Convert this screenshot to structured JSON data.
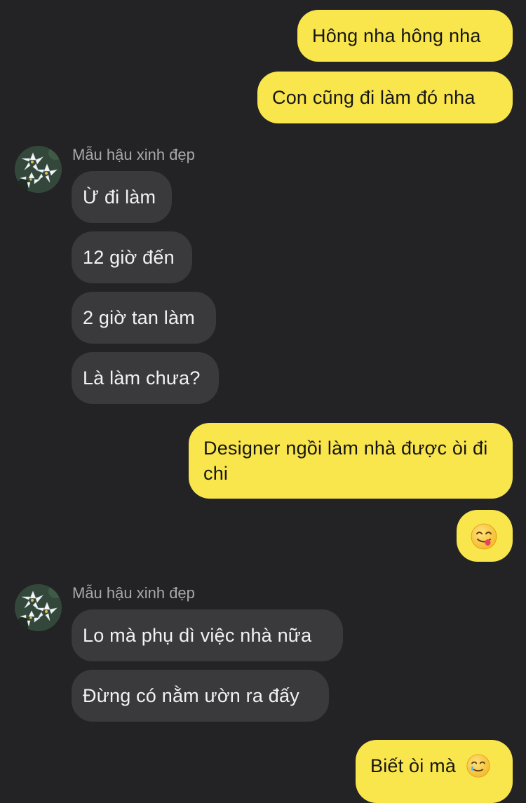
{
  "messages": [
    {
      "side": "out",
      "text": "Hông nha hông nha"
    },
    {
      "side": "out",
      "text": "Con cũng đi làm đó nha"
    },
    {
      "side": "in_header",
      "sender": "Mẫu hậu xinh đẹp"
    },
    {
      "side": "in",
      "text": "Ừ đi làm"
    },
    {
      "side": "in",
      "text": "12 giờ đến"
    },
    {
      "side": "in",
      "text": "2 giờ tan làm"
    },
    {
      "side": "in",
      "text": "Là làm chưa?"
    },
    {
      "side": "out",
      "text": "Designer ngồi làm nhà được òi đi chi"
    },
    {
      "side": "out",
      "emoji": "savoring-face-emoji"
    },
    {
      "side": "in_header",
      "sender": "Mẫu hậu xinh đẹp"
    },
    {
      "side": "in",
      "text": "Lo mà phụ dì việc nhà nữa"
    },
    {
      "side": "in",
      "text": "Đừng có nằm ườn ra đấy"
    },
    {
      "side": "out",
      "text": "Biết òi mà",
      "emoji": "smiling-face-with-tear-emoji"
    }
  ],
  "colors": {
    "background": "#232325",
    "outgoing_bubble": "#f9e54c",
    "incoming_bubble": "#3a3a3c",
    "sender_name": "#a8a8ac"
  }
}
